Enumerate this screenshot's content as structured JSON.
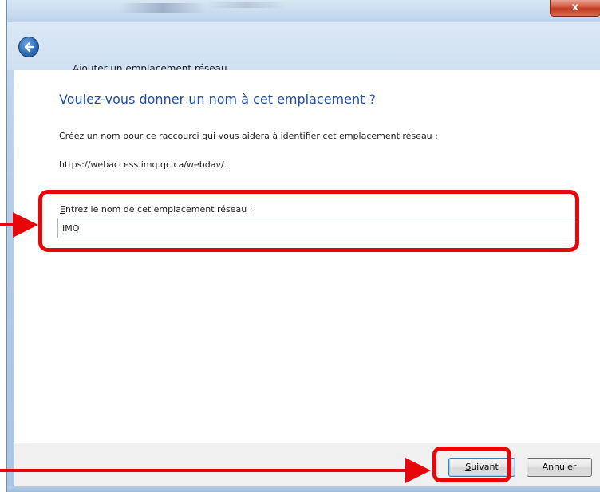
{
  "window": {
    "close_label": "x"
  },
  "wizard": {
    "title": "Ajouter un emplacement réseau"
  },
  "content": {
    "heading": "Voulez-vous donner un nom à cet emplacement ?",
    "description": "Créez un nom pour ce raccourci qui vous aidera à identifier cet emplacement réseau :",
    "url": "https://webaccess.imq.qc.ca/webdav/."
  },
  "name_field": {
    "label_accel": "E",
    "label_rest": "ntrez le nom de cet emplacement réseau :",
    "value": "IMQ"
  },
  "buttons": {
    "next_accel": "S",
    "next_rest": "uivant",
    "cancel": "Annuler"
  },
  "annotations": {
    "color": "#e8060b"
  },
  "icons": {
    "back": "back-arrow-icon",
    "close": "close-icon"
  }
}
